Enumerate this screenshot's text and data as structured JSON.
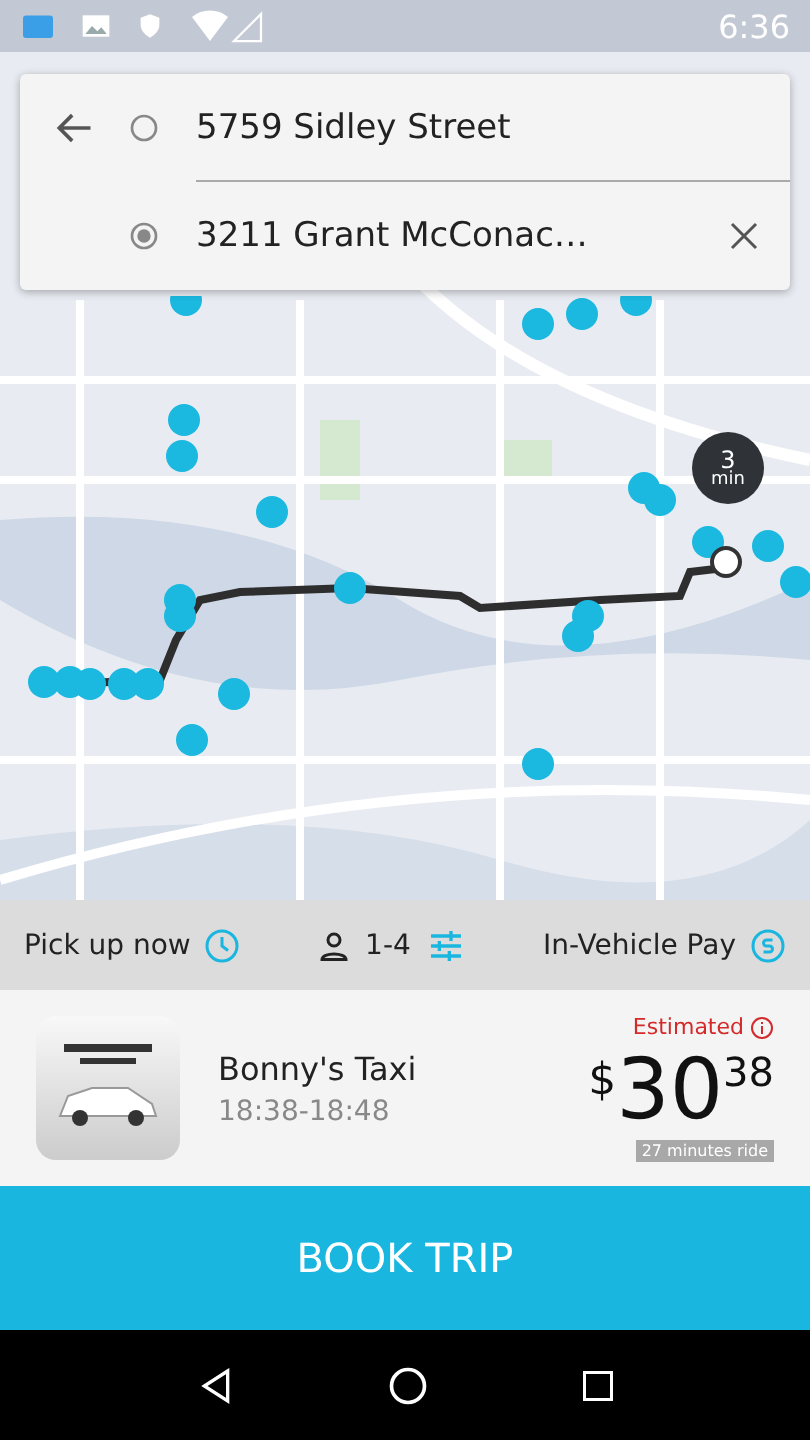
{
  "status_bar": {
    "time": "6:36"
  },
  "route": {
    "pickup": "5759 Sidley Street",
    "dropoff": "3211 Grant McConac…"
  },
  "eta_badge": {
    "value": "3",
    "unit": "min"
  },
  "options": [
    {
      "kind": "time",
      "label": "Pick up now"
    },
    {
      "kind": "passengers",
      "label": "1-4"
    },
    {
      "kind": "payment",
      "label": "In-Vehicle Pay"
    }
  ],
  "offer": {
    "company": "Bonny's Taxi",
    "window": "18:38-18:48",
    "estimate_label": "Estimated",
    "price_symbol": "$",
    "price_whole": "30",
    "price_cents": "38",
    "duration": "27 minutes ride"
  },
  "book_button": "BOOK TRIP"
}
